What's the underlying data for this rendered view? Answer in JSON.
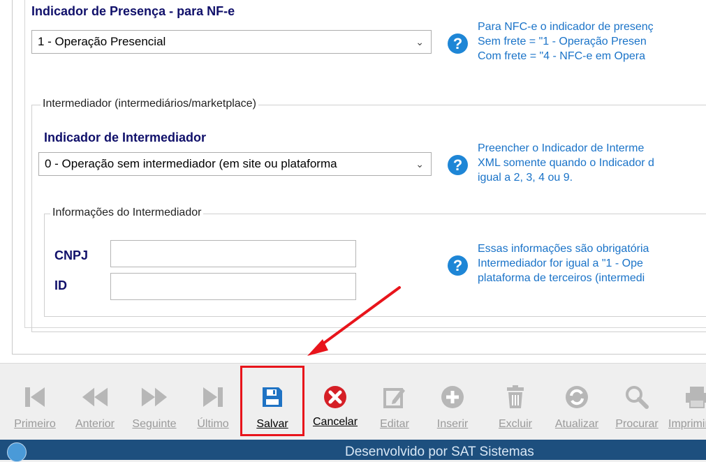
{
  "presence": {
    "title": "Indicador de Presença - para NF-e",
    "selected": "1 - Operação Presencial",
    "help_lines": [
      "Para NFC-e o indicador de presenç",
      "Sem frete = \"1 - Operação Presen",
      "Com frete = \"4 - NFC-e em Opera"
    ]
  },
  "intermediary_group": {
    "legend": "Intermediador (intermediários/marketplace)",
    "indicator_title": "Indicador de Intermediador",
    "selected": "0 - Operação sem intermediador (em site ou plataforma",
    "help_lines": [
      "Preencher o Indicador de Interme",
      "XML somente quando o Indicador d",
      "igual a 2, 3, 4 ou 9."
    ]
  },
  "info_group": {
    "legend": "Informações do Intermediador",
    "cnpj_label": "CNPJ",
    "cnpj_value": "",
    "id_label": "ID",
    "id_value": "",
    "help_lines": [
      "Essas informações são obrigatória",
      "Intermediador for igual a \"1 - Ope",
      "plataforma de terceiros (intermedi"
    ]
  },
  "toolbar": {
    "first": "Primeiro",
    "previous": "Anterior",
    "next": "Seguinte",
    "last": "Último",
    "save": "Salvar",
    "cancel": "Cancelar",
    "edit": "Editar",
    "insert": "Inserir",
    "delete": "Excluir",
    "refresh": "Atualizar",
    "search": "Procurar",
    "print": "Imprimir"
  },
  "status_bar": {
    "text": "Desenvolvido por SAT Sistemas"
  },
  "colors": {
    "title_blue": "#10106a",
    "help_blue": "#1a73c8",
    "highlight_red": "#e8141b",
    "status_bg": "#1d4f7e"
  }
}
